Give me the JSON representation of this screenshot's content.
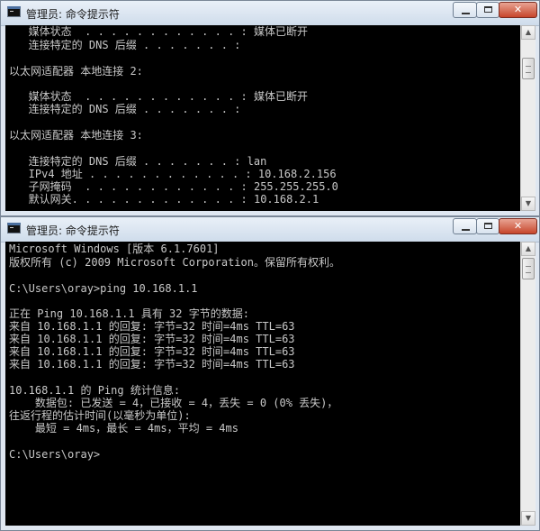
{
  "win1": {
    "title": "管理员: 命令提示符",
    "lines": [
      "   媒体状态  . . . . . . . . . . . . : 媒体已断开",
      "   连接特定的 DNS 后缀 . . . . . . . :",
      "",
      "以太网适配器 本地连接 2:",
      "",
      "   媒体状态  . . . . . . . . . . . . : 媒体已断开",
      "   连接特定的 DNS 后缀 . . . . . . . :",
      "",
      "以太网适配器 本地连接 3:",
      "",
      "   连接特定的 DNS 后缀 . . . . . . . : lan",
      "   IPv4 地址 . . . . . . . . . . . . : 10.168.2.156",
      "   子网掩码  . . . . . . . . . . . . : 255.255.255.0",
      "   默认网关. . . . . . . . . . . . . : 10.168.2.1"
    ]
  },
  "win2": {
    "title": "管理员: 命令提示符",
    "lines": [
      "Microsoft Windows [版本 6.1.7601]",
      "版权所有 (c) 2009 Microsoft Corporation。保留所有权利。",
      "",
      "C:\\Users\\oray>ping 10.168.1.1",
      "",
      "正在 Ping 10.168.1.1 具有 32 字节的数据:",
      "来自 10.168.1.1 的回复: 字节=32 时间=4ms TTL=63",
      "来自 10.168.1.1 的回复: 字节=32 时间=4ms TTL=63",
      "来自 10.168.1.1 的回复: 字节=32 时间=4ms TTL=63",
      "来自 10.168.1.1 的回复: 字节=32 时间=4ms TTL=63",
      "",
      "10.168.1.1 的 Ping 统计信息:",
      "    数据包: 已发送 = 4，已接收 = 4，丢失 = 0 (0% 丢失)，",
      "往返行程的估计时间(以毫秒为单位):",
      "    最短 = 4ms，最长 = 4ms，平均 = 4ms",
      "",
      "C:\\Users\\oray>"
    ]
  },
  "icons": {
    "title": "cmd-icon",
    "minimize": "minimize-icon",
    "maximize": "maximize-icon",
    "close": "close-icon",
    "scroll_up": "scroll-up-arrow-icon",
    "scroll_down": "scroll-down-arrow-icon"
  },
  "colors": {
    "console_bg": "#000000",
    "console_text": "#c8c8c8",
    "close_button": "#c7452b"
  }
}
